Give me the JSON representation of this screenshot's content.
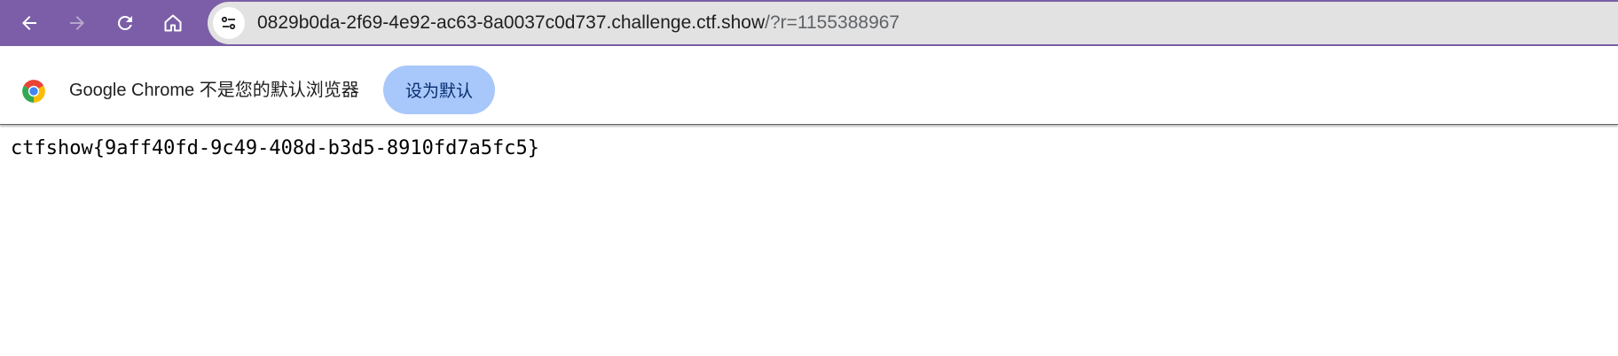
{
  "browser": {
    "nav": {
      "back_icon": "arrow-left-icon",
      "forward_icon": "arrow-right-icon",
      "reload_icon": "reload-icon",
      "home_icon": "home-icon"
    },
    "omnibox": {
      "site_info_icon": "tune-icon",
      "url_main": "0829b0da-2f69-4e92-ac63-8a0037c0d737.challenge.ctf.show",
      "url_query": "/?r=1155388967"
    },
    "colors": {
      "toolbar": "#7b5ea7",
      "omnibox": "#e2e2e2",
      "button": "#a8c7fa"
    }
  },
  "infobar": {
    "logo_icon": "chrome-logo-icon",
    "message": "Google Chrome 不是您的默认浏览器",
    "set_default_label": "设为默认"
  },
  "page": {
    "content": "ctfshow{9aff40fd-9c49-408d-b3d5-8910fd7a5fc5}"
  }
}
